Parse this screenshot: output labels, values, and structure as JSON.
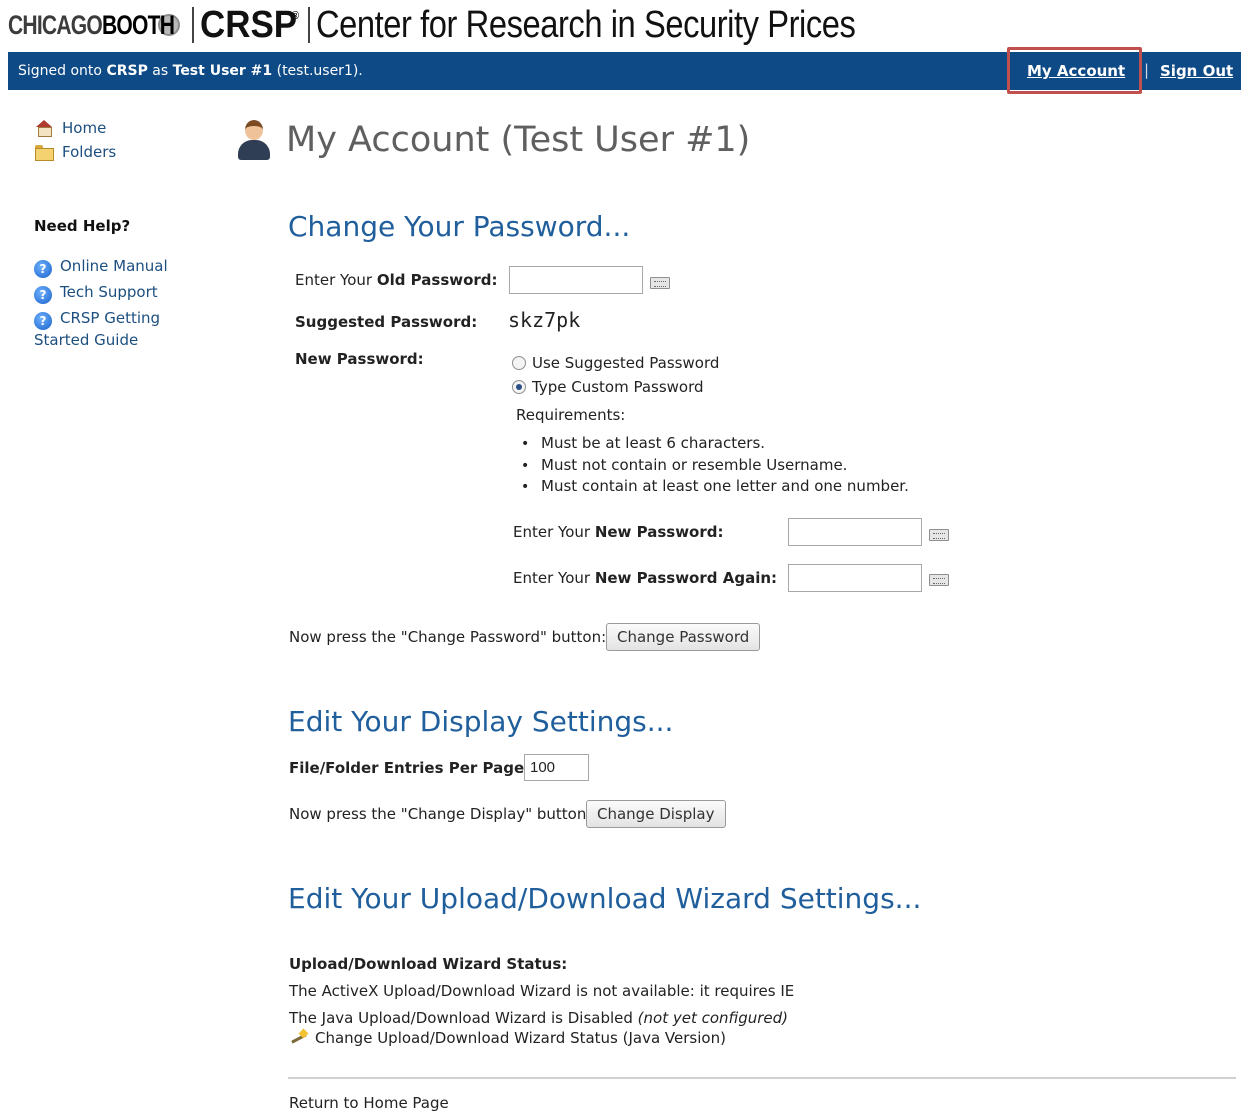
{
  "header": {
    "logo_chicago": "CHICAGO",
    "logo_booth": "BOOTH",
    "logo_crsp": "CRSP",
    "logo_reg": "®",
    "tagline": "Center for Research in Security Prices"
  },
  "topbar": {
    "signed_prefix": "Signed onto ",
    "app": "CRSP",
    "as_text": " as ",
    "user_name": "Test User #1",
    "user_id": " (test.user1).",
    "my_account": "My Account",
    "separator": "|",
    "sign_out": "Sign Out"
  },
  "nav": {
    "home": "Home",
    "folders": "Folders"
  },
  "help": {
    "heading": "Need Help?",
    "items": [
      "Online Manual",
      "Tech Support",
      "CRSP Getting Started Guide"
    ]
  },
  "page_title": "My Account (Test User #1)",
  "password": {
    "heading": "Change Your Password...",
    "old_prefix": "Enter Your ",
    "old_bold": "Old Password:",
    "suggested_label": "Suggested Password:",
    "suggested_value": "skz7pk",
    "new_label": "New Password:",
    "option_suggested": "Use Suggested Password",
    "option_custom": "Type Custom Password",
    "requirements_title": "Requirements:",
    "requirements": [
      "Must be at least 6 characters.",
      "Must not contain or resemble Username.",
      "Must contain at least one letter and one number."
    ],
    "new_prefix": "Enter Your ",
    "new_bold": "New Password:",
    "again_prefix": "Enter Your ",
    "again_bold": "New Password Again:",
    "press_text": "Now press the \"Change Password\" button:",
    "button": "Change Password"
  },
  "display": {
    "heading": "Edit Your Display Settings...",
    "entries_label": "File/Folder Entries Per Page:",
    "entries_value": "100",
    "press_text": "Now press the \"Change Display\" button:",
    "button": "Change Display"
  },
  "wizard": {
    "heading": "Edit Your Upload/Download Wizard Settings...",
    "status_label": "Upload/Download Wizard Status:",
    "activex_text": "The ActiveX Upload/Download Wizard is not available: it requires IE",
    "java_text": "The Java Upload/Download Wizard is Disabled ",
    "java_note": "(not yet configured)",
    "change_link": "Change Upload/Download Wizard Status (Java Version)"
  },
  "footer": {
    "return_link": "Return to Home Page"
  },
  "colors": {
    "topbar": "#0e4a86",
    "heading": "#205f9c",
    "highlight": "#c0504d",
    "link": "#1c4f80"
  }
}
